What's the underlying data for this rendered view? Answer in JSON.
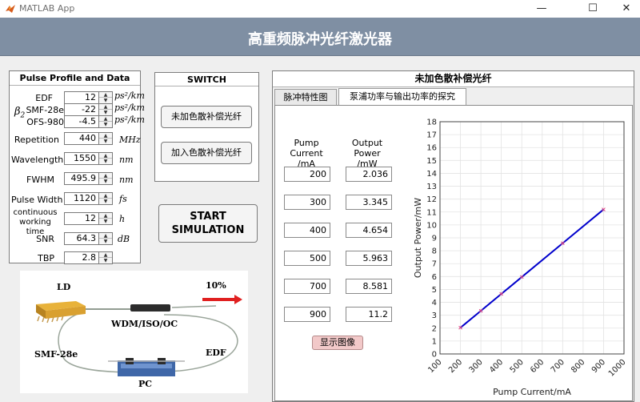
{
  "window": {
    "title": "MATLAB App",
    "icon": "matlab-logo-icon",
    "controls": [
      "minimize-icon",
      "maximize-icon",
      "close-icon"
    ]
  },
  "app_title": "高重频脉冲光纤激光器",
  "pulse_panel": {
    "title": "Pulse Profile and Data",
    "beta_symbol": "β2",
    "rows": [
      {
        "label": "EDF",
        "value": "12",
        "unit": "ps²/km"
      },
      {
        "label": "SMF-28e",
        "value": "-22",
        "unit": "ps²/km"
      },
      {
        "label": "OFS-980",
        "value": "-4.5",
        "unit": "ps²/km"
      },
      {
        "label": "Repetition",
        "value": "440",
        "unit": "MHz"
      },
      {
        "label": "Wavelength",
        "value": "1550",
        "unit": "nm"
      },
      {
        "label": "FWHM",
        "value": "495.9",
        "unit": "nm"
      },
      {
        "label": "Pulse Width",
        "value": "1120",
        "unit": "fs"
      },
      {
        "label": "continuous working time",
        "value": "12",
        "unit": "h"
      },
      {
        "label": "SNR",
        "value": "64.3",
        "unit": "dB"
      },
      {
        "label": "TBP",
        "value": "2.8",
        "unit": ""
      }
    ]
  },
  "switch_panel": {
    "title": "SWITCH",
    "btn_no_comp": "未加色散补偿光纤",
    "btn_with_comp": "加入色散补偿光纤"
  },
  "start_button": {
    "line1": "START",
    "line2": "SIMULATION"
  },
  "diagram": {
    "ld": "LD",
    "percent": "10%",
    "wdm": "WDM/ISO/OC",
    "smf": "SMF-28e",
    "edf": "EDF",
    "pc": "PC"
  },
  "right_panel": {
    "title": "未加色散补偿光纤",
    "tabs": [
      "脉冲特性图",
      "泵浦功率与输出功率的探究"
    ],
    "active_tab": 1,
    "col_pump": "Pump Current\n/mA",
    "col_output": "Output Power\n/mW",
    "table": [
      {
        "pump": "200",
        "output": "2.036"
      },
      {
        "pump": "300",
        "output": "3.345"
      },
      {
        "pump": "400",
        "output": "4.654"
      },
      {
        "pump": "500",
        "output": "5.963"
      },
      {
        "pump": "700",
        "output": "8.581"
      },
      {
        "pump": "900",
        "output": "11.2"
      }
    ],
    "show_button": "显示图像"
  },
  "chart_data": {
    "type": "line",
    "title": "",
    "xlabel": "Pump Current/mA",
    "ylabel": "Output Power/mW",
    "xlim": [
      100,
      1000
    ],
    "ylim": [
      0,
      18
    ],
    "xticks": [
      100,
      200,
      300,
      400,
      500,
      600,
      700,
      800,
      900,
      1000
    ],
    "yticks": [
      0,
      1,
      2,
      3,
      4,
      5,
      6,
      7,
      8,
      9,
      10,
      11,
      12,
      13,
      14,
      15,
      16,
      17,
      18
    ],
    "grid": true,
    "series": [
      {
        "x": [
          200,
          300,
          400,
          500,
          700,
          900
        ],
        "y": [
          2.036,
          3.345,
          4.654,
          5.963,
          8.581,
          11.2
        ],
        "color": "#0000cc",
        "marker_color": "#e04080"
      }
    ]
  },
  "colors": {
    "header_bg": "#7f8fa3",
    "body_bg": "#efefef",
    "line": "#0000cc",
    "show_btn": "#f2c9c9"
  }
}
